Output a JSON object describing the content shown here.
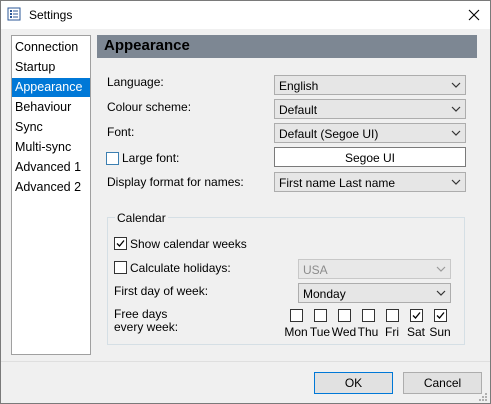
{
  "window": {
    "title": "Settings"
  },
  "nav": {
    "items": [
      "Connection",
      "Startup",
      "Appearance",
      "Behaviour",
      "Sync",
      "Multi-sync",
      "Advanced 1",
      "Advanced 2"
    ],
    "selected": "Appearance"
  },
  "panel": {
    "title": "Appearance",
    "language": {
      "label": "Language:",
      "value": "English"
    },
    "colour_scheme": {
      "label": "Colour scheme:",
      "value": "Default"
    },
    "font": {
      "label": "Font:",
      "value": "Default (Segoe UI)"
    },
    "large_font": {
      "label": "Large font:",
      "checked": false,
      "value": "Segoe UI"
    },
    "display_format": {
      "label": "Display format for names:",
      "value": "First name Last name"
    }
  },
  "calendar": {
    "title": "Calendar",
    "show_weeks": {
      "label": "Show calendar weeks",
      "checked": true
    },
    "holidays": {
      "label": "Calculate holidays:",
      "checked": false,
      "value": "USA"
    },
    "first_day": {
      "label": "First day of week:",
      "value": "Monday"
    },
    "free_days": {
      "label_line1": "Free days",
      "label_line2": "every week:"
    },
    "days": [
      {
        "name": "Mon",
        "checked": false
      },
      {
        "name": "Tue",
        "checked": false
      },
      {
        "name": "Wed",
        "checked": false
      },
      {
        "name": "Thu",
        "checked": false
      },
      {
        "name": "Fri",
        "checked": false
      },
      {
        "name": "Sat",
        "checked": true
      },
      {
        "name": "Sun",
        "checked": true
      }
    ]
  },
  "buttons": {
    "ok": "OK",
    "cancel": "Cancel"
  },
  "icons": {
    "app": "settings-app-icon",
    "close": "close-icon",
    "chevron": "chevron-down-icon",
    "check": "checkmark-icon",
    "grip": "resize-grip-icon"
  },
  "colors": {
    "selection": "#0078d7",
    "header": "#7d8793"
  }
}
